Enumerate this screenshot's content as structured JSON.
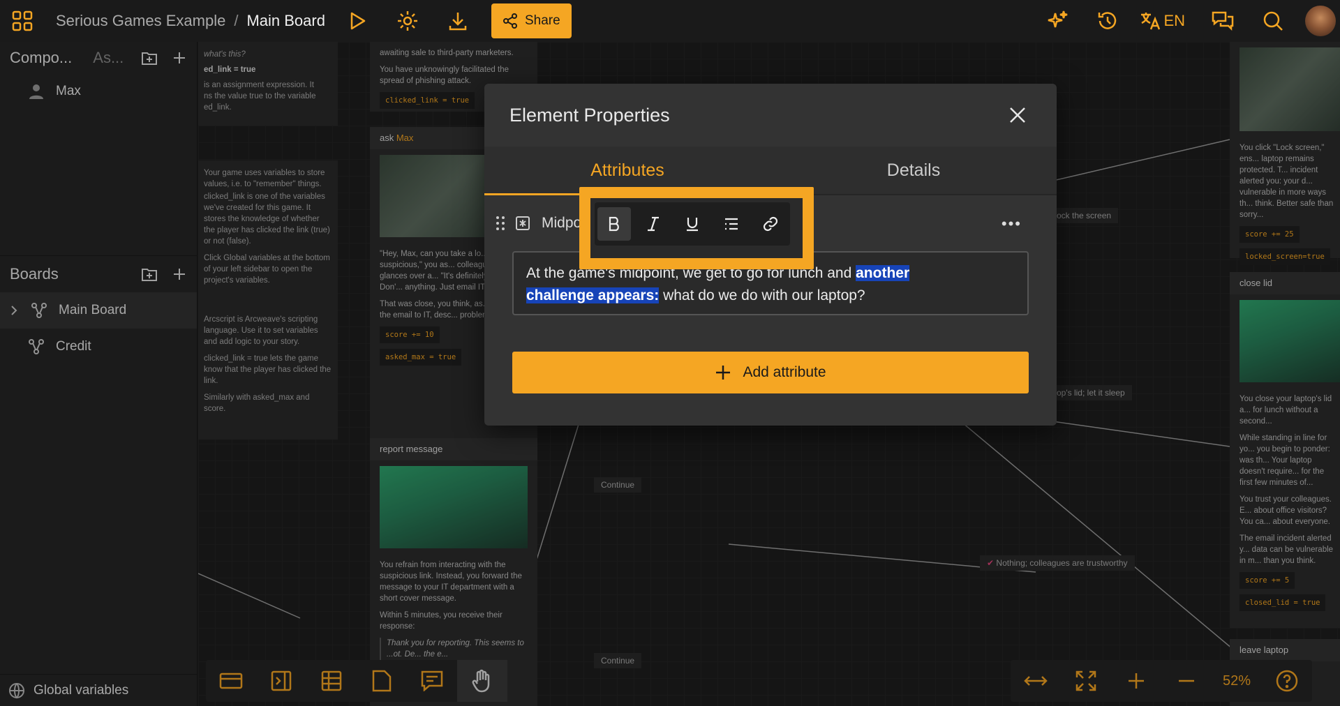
{
  "header": {
    "project": "Serious Games Example",
    "separator": "/",
    "board": "Main Board",
    "share_label": "Share",
    "language": "EN"
  },
  "sidebar": {
    "components_title": "Compo...",
    "assets_tab": "As...",
    "components": [
      {
        "label": "Max"
      }
    ],
    "boards_title": "Boards",
    "boards": [
      {
        "label": "Main Board"
      },
      {
        "label": "Credit"
      }
    ],
    "global_variables": "Global variables"
  },
  "canvas": {
    "note1": {
      "line1": "what's this?",
      "line2": "ed_link = true",
      "line3": "is an assignment expression. It",
      "line4": "ns the value true to the variable",
      "line5": "ed_link."
    },
    "note2": {
      "p1": "Your game uses variables to store values, i.e. to \"remember\" things.",
      "p2": "clicked_link is one of the variables we've created for this game. It stores the knowledge of whether the player has clicked the link (true) or not (false).",
      "p3": "Click Global variables at the bottom of your left sidebar to open the project's variables."
    },
    "note3": {
      "p1": "Arcscript is Arcweave's scripting language. Use it to set variables and add logic to your story.",
      "p2": "clicked_link = true lets the game know that the player has clicked the link.",
      "p3": "Similarly with asked_max and score."
    },
    "card_top": {
      "line1": "awaiting sale to third-party marketers.",
      "line2": "You have unknowingly facilitated the spread of phishing attack.",
      "code": "clicked_link = true"
    },
    "card_ask": {
      "title_prefix": "ask ",
      "title_name": "Max",
      "p1": "\"Hey, Max, can you take a lo... It seems suspicious,\" you as... colleague. He glances over a... \"It's definitely phishing. Don'... anything. Just email IT about...",
      "p2": "That was close, you think, as... forward the email to IT, desc... problem.",
      "code1": "score += 10",
      "code2": "asked_max = true"
    },
    "card_report": {
      "title": "report message",
      "p1": "You refrain from interacting with the suspicious link. Instead, you forward the message to your IT department with a short cover message.",
      "p2": "Within 5 minutes, you receive their response:",
      "p3": "Thank you for reporting. This seems to ...ot. De... the e..."
    },
    "conn_labels": {
      "lock": "ock the screen",
      "continue1": "Continue",
      "continue2": "Continue",
      "sleep": "op's lid; let it sleep",
      "trust": "Nothing; colleagues are trustworthy"
    },
    "right_cards": {
      "lock_text": "You click \"Lock screen,\" ens... laptop remains protected. T... incident alerted you: your d... vulnerable in more ways th... think. Better safe than sorry...",
      "lock_code1": "score += 25",
      "lock_code2": "locked_screen=true",
      "close_title": "close lid",
      "close_p1": "You close your laptop's lid a... for lunch without a second...",
      "close_p2": "While standing in line for yo... you begin to ponder: was th... Your laptop doesn't require... for the first few minutes of...",
      "close_p3": "You trust your colleagues. E... about office visitors? You ca... about everyone.",
      "close_p4": "The email incident alerted y... data can be vulnerable in m... than you think.",
      "close_code1": "score += 5",
      "close_code2": "closed_lid = true",
      "leave_title": "leave laptop"
    }
  },
  "zoom": {
    "level": "52%"
  },
  "modal": {
    "title": "Element Properties",
    "tabs": [
      {
        "label": "Attributes"
      },
      {
        "label": "Details"
      }
    ],
    "attribute": {
      "name": "Midpoin",
      "text_before": "At the game's midpoint, we get to go for lunch and ",
      "text_highlight1": "another",
      "text_highlight2": "challenge appears:",
      "text_after": " what do we do with our laptop?"
    },
    "add_attribute_label": "Add attribute"
  },
  "colors": {
    "accent": "#f5a623",
    "selection": "#1744b8",
    "background": "#1e1e1e"
  }
}
